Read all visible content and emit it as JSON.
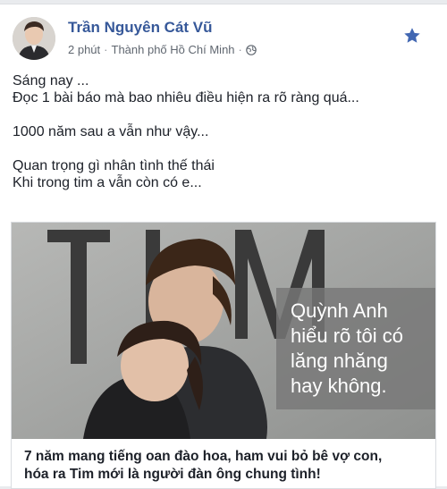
{
  "post": {
    "author": "Trần Nguyên Cát Vũ",
    "time": "2 phút",
    "separator": "·",
    "location": "Thành phố Hồ Chí Minh",
    "separator2": "·",
    "icons": {
      "avatar": "profile-photo",
      "privacy": "globe-icon",
      "favorite": "star-icon"
    },
    "lines": [
      "Sáng nay ...",
      "Đọc 1 bài báo mà bao nhiêu điều hiện ra rõ ràng quá...",
      "",
      "1000 năm sau a vẫn như vậy...",
      "",
      "Quan trọng gì nhân tình thế thái",
      "Khi trong tim a vẫn còn có e..."
    ]
  },
  "link_preview": {
    "magazine_masthead": "TIM",
    "quote_lines": [
      "Quỳnh Anh",
      "hiểu rõ tôi có",
      "lăng nhăng",
      "hay không."
    ],
    "title_lines": [
      "7 năm mang tiếng oan đào hoa, ham vui bỏ bê vợ con,",
      "hóa ra Tim mới là người đàn ông chung tình!"
    ]
  },
  "colors": {
    "author_link": "#365899",
    "star": "#4267b2",
    "meta_text": "#606770"
  }
}
